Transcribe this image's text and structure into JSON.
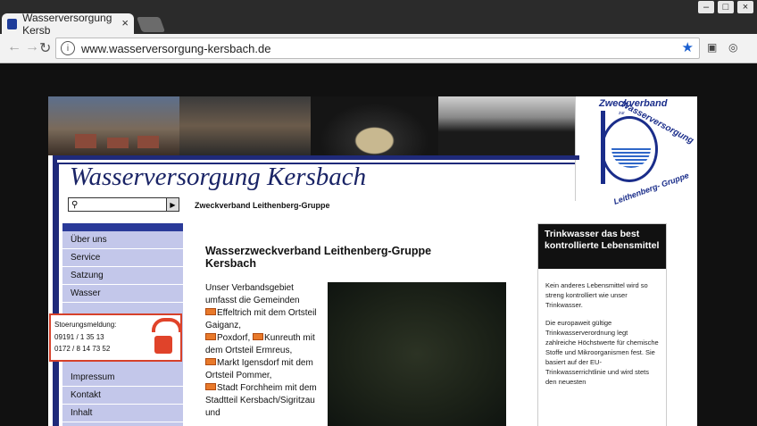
{
  "browser": {
    "tab_title": "Wasserversorgung Kersb",
    "tab_close": "×",
    "url": "www.wasserversorgung-kersbach.de",
    "win_buttons": [
      "–",
      "□",
      "×"
    ]
  },
  "site": {
    "title": "Wasserversorgung Kersbach",
    "subtitle": "Zweckverband Leithenberg-Gruppe",
    "logo_top": "Zweckverband",
    "logo_zur": "zur",
    "logo_arc": "Wasserversorgung",
    "logo_bottom": "Leithenberg- Gruppe",
    "logo_der": "der"
  },
  "nav": {
    "items_top": [
      "Über uns",
      "Service",
      "Satzung",
      "Wasser"
    ],
    "items_bottom": [
      "Impressum",
      "Kontakt",
      "Inhalt"
    ]
  },
  "stoerung": {
    "label": "Stoerungsmeldung:",
    "phone1": "09191 / 1 35 13",
    "phone2": "0172 / 8 14 73 52"
  },
  "main": {
    "heading": "Wasserzweckverband Leithenberg-Gruppe Kersbach",
    "intro": "Unser Verbandsgebiet umfasst die Gemeinden",
    "lines": [
      {
        "text": "Effeltrich mit dem Ortsteil Gaiganz,"
      },
      {
        "text": "Poxdorf,"
      },
      {
        "text": "Kunreuth mit dem Ortsteil Ermreus,"
      },
      {
        "text": "Markt Igensdorf mit dem Ortsteil Pommer,"
      },
      {
        "text": "Stadt Forchheim mit dem Stadtteil Kersbach/Sigritzau und"
      }
    ]
  },
  "sidebox": {
    "heading": "Trinkwasser das best kontrollierte Lebensmittel",
    "p1": "Kein anderes Lebensmittel wird so streng kontrolliert wie unser Trinkwasser.",
    "p2": "Die europaweit gültige Trinkwasserverordnung legt zahlreiche Höchstwerte für chemische Stoffe und Mikroorganismen fest. Sie basiert auf der EU-Trinkwasserrichtlinie und wird stets den neuesten"
  },
  "colors": {
    "nav_bg": "#c3c7ea",
    "frame_blue": "#1f2a7a",
    "accent_red": "#d6412a"
  }
}
